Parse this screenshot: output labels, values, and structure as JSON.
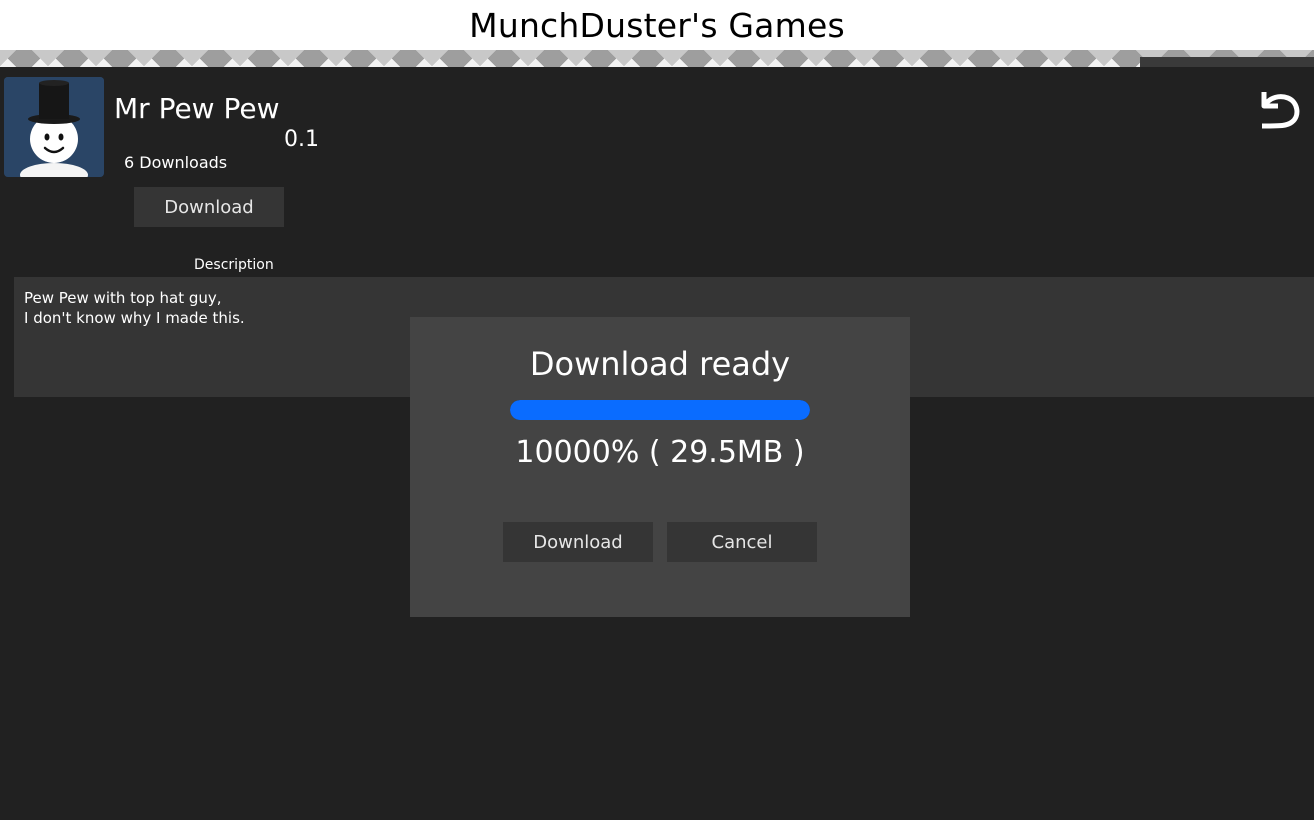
{
  "header": {
    "site_title": "MunchDuster's Games"
  },
  "game": {
    "title": "Mr Pew Pew",
    "version": "0.1",
    "downloads": "6 Downloads",
    "download_label": "Download"
  },
  "description": {
    "label": "Description",
    "lines": [
      "Pew Pew with top hat guy,",
      "I don't know why I made this."
    ]
  },
  "modal": {
    "title": "Download ready",
    "progress_text": "10000% ( 29.5MB )",
    "progress_fraction": 1.0,
    "download_label": "Download",
    "cancel_label": "Cancel"
  },
  "icons": {
    "back": "undo-arrow-icon",
    "thumbnail": "snowman-top-hat-thumbnail"
  },
  "colors": {
    "background": "#212121",
    "panel": "#353535",
    "modal": "#444444",
    "progress": "#0a6cff"
  }
}
